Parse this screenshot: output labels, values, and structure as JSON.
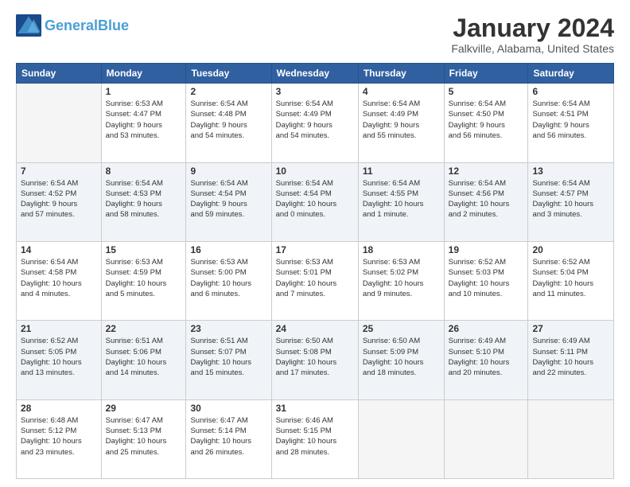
{
  "header": {
    "logo_general": "General",
    "logo_blue": "Blue",
    "month": "January 2024",
    "location": "Falkville, Alabama, United States"
  },
  "weekdays": [
    "Sunday",
    "Monday",
    "Tuesday",
    "Wednesday",
    "Thursday",
    "Friday",
    "Saturday"
  ],
  "weeks": [
    [
      {
        "day": "",
        "sunrise": "",
        "sunset": "",
        "daylight": ""
      },
      {
        "day": "1",
        "sunrise": "Sunrise: 6:53 AM",
        "sunset": "Sunset: 4:47 PM",
        "daylight": "Daylight: 9 hours and 53 minutes."
      },
      {
        "day": "2",
        "sunrise": "Sunrise: 6:54 AM",
        "sunset": "Sunset: 4:48 PM",
        "daylight": "Daylight: 9 hours and 54 minutes."
      },
      {
        "day": "3",
        "sunrise": "Sunrise: 6:54 AM",
        "sunset": "Sunset: 4:49 PM",
        "daylight": "Daylight: 9 hours and 54 minutes."
      },
      {
        "day": "4",
        "sunrise": "Sunrise: 6:54 AM",
        "sunset": "Sunset: 4:49 PM",
        "daylight": "Daylight: 9 hours and 55 minutes."
      },
      {
        "day": "5",
        "sunrise": "Sunrise: 6:54 AM",
        "sunset": "Sunset: 4:50 PM",
        "daylight": "Daylight: 9 hours and 56 minutes."
      },
      {
        "day": "6",
        "sunrise": "Sunrise: 6:54 AM",
        "sunset": "Sunset: 4:51 PM",
        "daylight": "Daylight: 9 hours and 56 minutes."
      }
    ],
    [
      {
        "day": "7",
        "sunrise": "Sunrise: 6:54 AM",
        "sunset": "Sunset: 4:52 PM",
        "daylight": "Daylight: 9 hours and 57 minutes."
      },
      {
        "day": "8",
        "sunrise": "Sunrise: 6:54 AM",
        "sunset": "Sunset: 4:53 PM",
        "daylight": "Daylight: 9 hours and 58 minutes."
      },
      {
        "day": "9",
        "sunrise": "Sunrise: 6:54 AM",
        "sunset": "Sunset: 4:54 PM",
        "daylight": "Daylight: 9 hours and 59 minutes."
      },
      {
        "day": "10",
        "sunrise": "Sunrise: 6:54 AM",
        "sunset": "Sunset: 4:54 PM",
        "daylight": "Daylight: 10 hours and 0 minutes."
      },
      {
        "day": "11",
        "sunrise": "Sunrise: 6:54 AM",
        "sunset": "Sunset: 4:55 PM",
        "daylight": "Daylight: 10 hours and 1 minute."
      },
      {
        "day": "12",
        "sunrise": "Sunrise: 6:54 AM",
        "sunset": "Sunset: 4:56 PM",
        "daylight": "Daylight: 10 hours and 2 minutes."
      },
      {
        "day": "13",
        "sunrise": "Sunrise: 6:54 AM",
        "sunset": "Sunset: 4:57 PM",
        "daylight": "Daylight: 10 hours and 3 minutes."
      }
    ],
    [
      {
        "day": "14",
        "sunrise": "Sunrise: 6:54 AM",
        "sunset": "Sunset: 4:58 PM",
        "daylight": "Daylight: 10 hours and 4 minutes."
      },
      {
        "day": "15",
        "sunrise": "Sunrise: 6:53 AM",
        "sunset": "Sunset: 4:59 PM",
        "daylight": "Daylight: 10 hours and 5 minutes."
      },
      {
        "day": "16",
        "sunrise": "Sunrise: 6:53 AM",
        "sunset": "Sunset: 5:00 PM",
        "daylight": "Daylight: 10 hours and 6 minutes."
      },
      {
        "day": "17",
        "sunrise": "Sunrise: 6:53 AM",
        "sunset": "Sunset: 5:01 PM",
        "daylight": "Daylight: 10 hours and 7 minutes."
      },
      {
        "day": "18",
        "sunrise": "Sunrise: 6:53 AM",
        "sunset": "Sunset: 5:02 PM",
        "daylight": "Daylight: 10 hours and 9 minutes."
      },
      {
        "day": "19",
        "sunrise": "Sunrise: 6:52 AM",
        "sunset": "Sunset: 5:03 PM",
        "daylight": "Daylight: 10 hours and 10 minutes."
      },
      {
        "day": "20",
        "sunrise": "Sunrise: 6:52 AM",
        "sunset": "Sunset: 5:04 PM",
        "daylight": "Daylight: 10 hours and 11 minutes."
      }
    ],
    [
      {
        "day": "21",
        "sunrise": "Sunrise: 6:52 AM",
        "sunset": "Sunset: 5:05 PM",
        "daylight": "Daylight: 10 hours and 13 minutes."
      },
      {
        "day": "22",
        "sunrise": "Sunrise: 6:51 AM",
        "sunset": "Sunset: 5:06 PM",
        "daylight": "Daylight: 10 hours and 14 minutes."
      },
      {
        "day": "23",
        "sunrise": "Sunrise: 6:51 AM",
        "sunset": "Sunset: 5:07 PM",
        "daylight": "Daylight: 10 hours and 15 minutes."
      },
      {
        "day": "24",
        "sunrise": "Sunrise: 6:50 AM",
        "sunset": "Sunset: 5:08 PM",
        "daylight": "Daylight: 10 hours and 17 minutes."
      },
      {
        "day": "25",
        "sunrise": "Sunrise: 6:50 AM",
        "sunset": "Sunset: 5:09 PM",
        "daylight": "Daylight: 10 hours and 18 minutes."
      },
      {
        "day": "26",
        "sunrise": "Sunrise: 6:49 AM",
        "sunset": "Sunset: 5:10 PM",
        "daylight": "Daylight: 10 hours and 20 minutes."
      },
      {
        "day": "27",
        "sunrise": "Sunrise: 6:49 AM",
        "sunset": "Sunset: 5:11 PM",
        "daylight": "Daylight: 10 hours and 22 minutes."
      }
    ],
    [
      {
        "day": "28",
        "sunrise": "Sunrise: 6:48 AM",
        "sunset": "Sunset: 5:12 PM",
        "daylight": "Daylight: 10 hours and 23 minutes."
      },
      {
        "day": "29",
        "sunrise": "Sunrise: 6:47 AM",
        "sunset": "Sunset: 5:13 PM",
        "daylight": "Daylight: 10 hours and 25 minutes."
      },
      {
        "day": "30",
        "sunrise": "Sunrise: 6:47 AM",
        "sunset": "Sunset: 5:14 PM",
        "daylight": "Daylight: 10 hours and 26 minutes."
      },
      {
        "day": "31",
        "sunrise": "Sunrise: 6:46 AM",
        "sunset": "Sunset: 5:15 PM",
        "daylight": "Daylight: 10 hours and 28 minutes."
      },
      {
        "day": "",
        "sunrise": "",
        "sunset": "",
        "daylight": ""
      },
      {
        "day": "",
        "sunrise": "",
        "sunset": "",
        "daylight": ""
      },
      {
        "day": "",
        "sunrise": "",
        "sunset": "",
        "daylight": ""
      }
    ]
  ]
}
